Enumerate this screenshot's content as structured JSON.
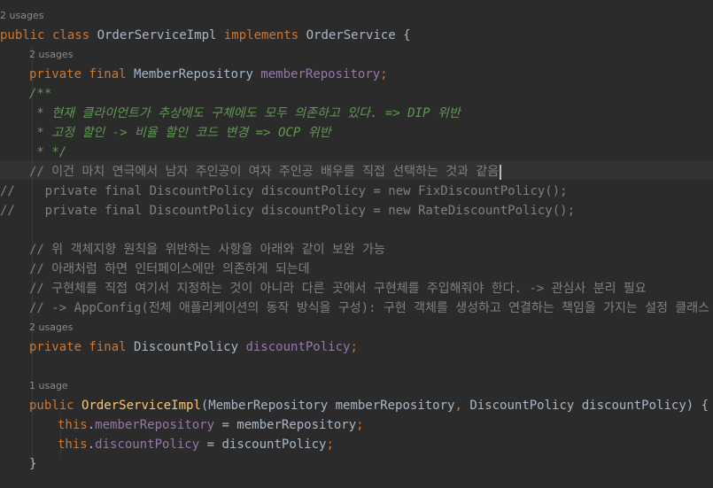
{
  "editor": {
    "lines": [
      {
        "hint": "2 usages"
      },
      {
        "tokens": [
          [
            "kw",
            "public class "
          ],
          [
            "cls",
            "OrderServiceImpl "
          ],
          [
            "kw",
            "implements "
          ],
          [
            "cls",
            "OrderService {"
          ]
        ]
      },
      {
        "hint": "2 usages"
      },
      {
        "tokens": [
          [
            "kw",
            "private final "
          ],
          [
            "cls",
            "MemberRepository "
          ],
          [
            "fld",
            "memberRepository"
          ],
          [
            "kw",
            ";"
          ]
        ]
      },
      {
        "tokens": [
          [
            "doc",
            "/**"
          ]
        ]
      },
      {
        "tokens": [
          [
            "doc",
            " * 현재 클라이언트가 추상에도 구체에도 모두 의존하고 있다. => DIP 위반"
          ]
        ]
      },
      {
        "tokens": [
          [
            "doc",
            " * 고정 할인 -> 비율 할인 코드 변경 => OCP 위반"
          ]
        ]
      },
      {
        "tokens": [
          [
            "doc",
            " * */"
          ]
        ]
      },
      {
        "tokens": [
          [
            "cmt",
            "// 이건 마치 연극에서 남자 주인공이 여자 주인공 배우를 직접 선택하는 것과 같음"
          ]
        ],
        "caret": true
      },
      {
        "tokens": [
          [
            "cmt",
            "//    private final DiscountPolicy discountPolicy = new FixDiscountPolicy();"
          ]
        ]
      },
      {
        "tokens": [
          [
            "cmt",
            "//    private final DiscountPolicy discountPolicy = new RateDiscountPolicy();"
          ]
        ]
      },
      {
        "tokens": []
      },
      {
        "tokens": [
          [
            "cmt",
            "// 위 객체지향 원칙을 위반하는 사항을 아래와 같이 보완 가능"
          ]
        ]
      },
      {
        "tokens": [
          [
            "cmt",
            "// 아래처럼 하면 인터페이스에만 의존하게 되는데"
          ]
        ]
      },
      {
        "tokens": [
          [
            "cmt",
            "// 구현체를 직접 여기서 지정하는 것이 아니라 다른 곳에서 구현체를 주입해줘야 한다. -> 관심사 분리 필요"
          ]
        ]
      },
      {
        "tokens": [
          [
            "cmt",
            "// -> AppConfig(전체 애플리케이션의 동작 방식을 구성): 구현 객체를 생성하고 연결하는 책임을 가지는 설정 클래스"
          ]
        ]
      },
      {
        "hint": "2 usages"
      },
      {
        "tokens": [
          [
            "kw",
            "private final "
          ],
          [
            "cls",
            "DiscountPolicy "
          ],
          [
            "fld",
            "discountPolicy"
          ],
          [
            "kw",
            ";"
          ]
        ]
      },
      {
        "tokens": []
      },
      {
        "hint": "1 usage"
      },
      {
        "tokens": [
          [
            "kw",
            "public "
          ],
          [
            "fn",
            "OrderServiceImpl"
          ],
          [
            "plain",
            "(MemberRepository memberRepository"
          ],
          [
            "kw",
            ", "
          ],
          [
            "plain",
            "DiscountPolicy discountPolicy) {"
          ]
        ]
      },
      {
        "tokens": [
          [
            "kw",
            "this"
          ],
          [
            "plain",
            "."
          ],
          [
            "fld",
            "memberRepository"
          ],
          [
            "plain",
            " = memberRepository"
          ],
          [
            "kw",
            ";"
          ]
        ]
      },
      {
        "tokens": [
          [
            "kw",
            "this"
          ],
          [
            "plain",
            "."
          ],
          [
            "fld",
            "discountPolicy"
          ],
          [
            "plain",
            " = discountPolicy"
          ],
          [
            "kw",
            ";"
          ]
        ]
      },
      {
        "tokens": [
          [
            "plain",
            "}"
          ]
        ]
      }
    ]
  }
}
